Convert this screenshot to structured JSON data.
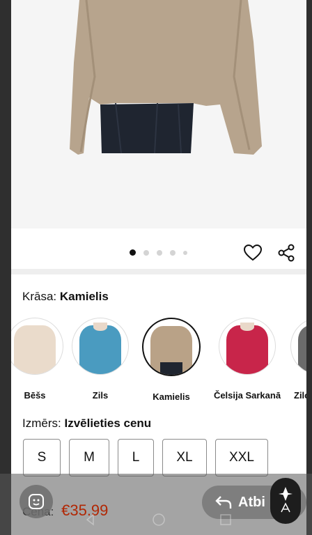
{
  "gallery": {
    "dots": [
      true,
      false,
      false,
      false,
      false
    ],
    "favorite_icon": "heart-outline-icon",
    "share_icon": "share-icon"
  },
  "color": {
    "label": "Krāsa:",
    "selected": "Kamielis",
    "options": [
      {
        "name": "Bēšs",
        "color": "#eadbcb"
      },
      {
        "name": "Zils",
        "color": "#4a9bc0"
      },
      {
        "name": "Kamielis",
        "color": "#b9a287"
      },
      {
        "name": "Čelsija Sarkanā",
        "color": "#c8254a"
      },
      {
        "name": "Ziloni",
        "color": "#6b6b6b"
      }
    ]
  },
  "size": {
    "label": "Izmērs:",
    "selected": "Izvēlieties cenu",
    "options": [
      "S",
      "M",
      "L",
      "XL",
      "XXL"
    ]
  },
  "footer": {
    "price_label": "Cena:",
    "price": "€35.99",
    "back_label": "Atbi"
  },
  "colors": {
    "accent_price": "#b12704"
  }
}
